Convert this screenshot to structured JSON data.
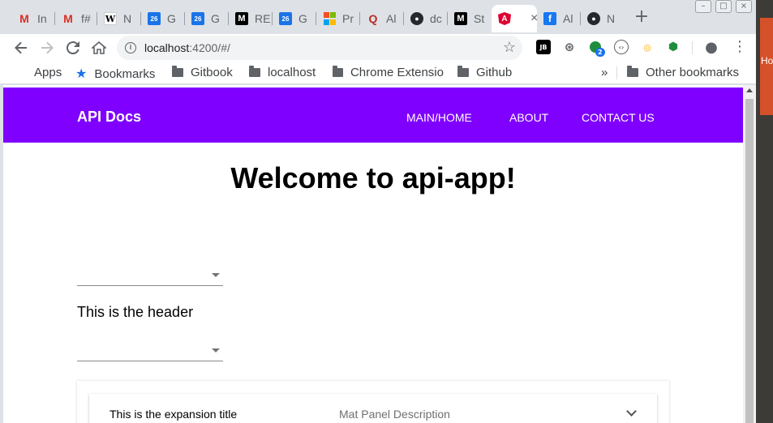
{
  "browser": {
    "tabs": [
      {
        "label": "In",
        "icon": "gmail-icon"
      },
      {
        "label": "f#",
        "icon": "gmail-icon"
      },
      {
        "label": "N",
        "icon": "wikipedia-icon"
      },
      {
        "label": "G",
        "icon": "calendar-icon"
      },
      {
        "label": "G",
        "icon": "calendar-icon"
      },
      {
        "label": "RE",
        "icon": "medium-icon"
      },
      {
        "label": "G",
        "icon": "calendar-icon"
      },
      {
        "label": "Pr",
        "icon": "microsoft-icon"
      },
      {
        "label": "Al",
        "icon": "quora-icon"
      },
      {
        "label": "dc",
        "icon": "github-icon"
      },
      {
        "label": "St",
        "icon": "medium-icon"
      },
      {
        "label": "",
        "icon": "angular-icon",
        "active": true
      },
      {
        "label": "Al",
        "icon": "facebook-icon"
      },
      {
        "label": "N",
        "icon": "github-icon"
      }
    ],
    "new_tab": "+",
    "address": {
      "host": "localhost",
      "path": ":4200/#/"
    },
    "extension_badge": "2",
    "bookmarks": [
      {
        "label": "Apps",
        "icon": "apps-grid-icon"
      },
      {
        "label": "Bookmarks",
        "icon": "star-icon"
      },
      {
        "label": "Gitbook",
        "icon": "folder-icon"
      },
      {
        "label": "localhost",
        "icon": "folder-icon"
      },
      {
        "label": "Chrome Extensio",
        "icon": "folder-icon"
      },
      {
        "label": "Github",
        "icon": "folder-icon"
      }
    ],
    "overflow": "»",
    "other_bookmarks": "Other bookmarks",
    "desktop_hint": "Ho"
  },
  "app": {
    "title": "API Docs",
    "nav": [
      "MAIN/HOME",
      "ABOUT",
      "CONTACT US"
    ],
    "welcome": "Welcome to api-app!",
    "header_text": "This is the header",
    "expansion": {
      "title": "This is the expansion title",
      "description": "Mat Panel Description"
    },
    "colors": {
      "toolbar": "#7f00ff"
    }
  }
}
